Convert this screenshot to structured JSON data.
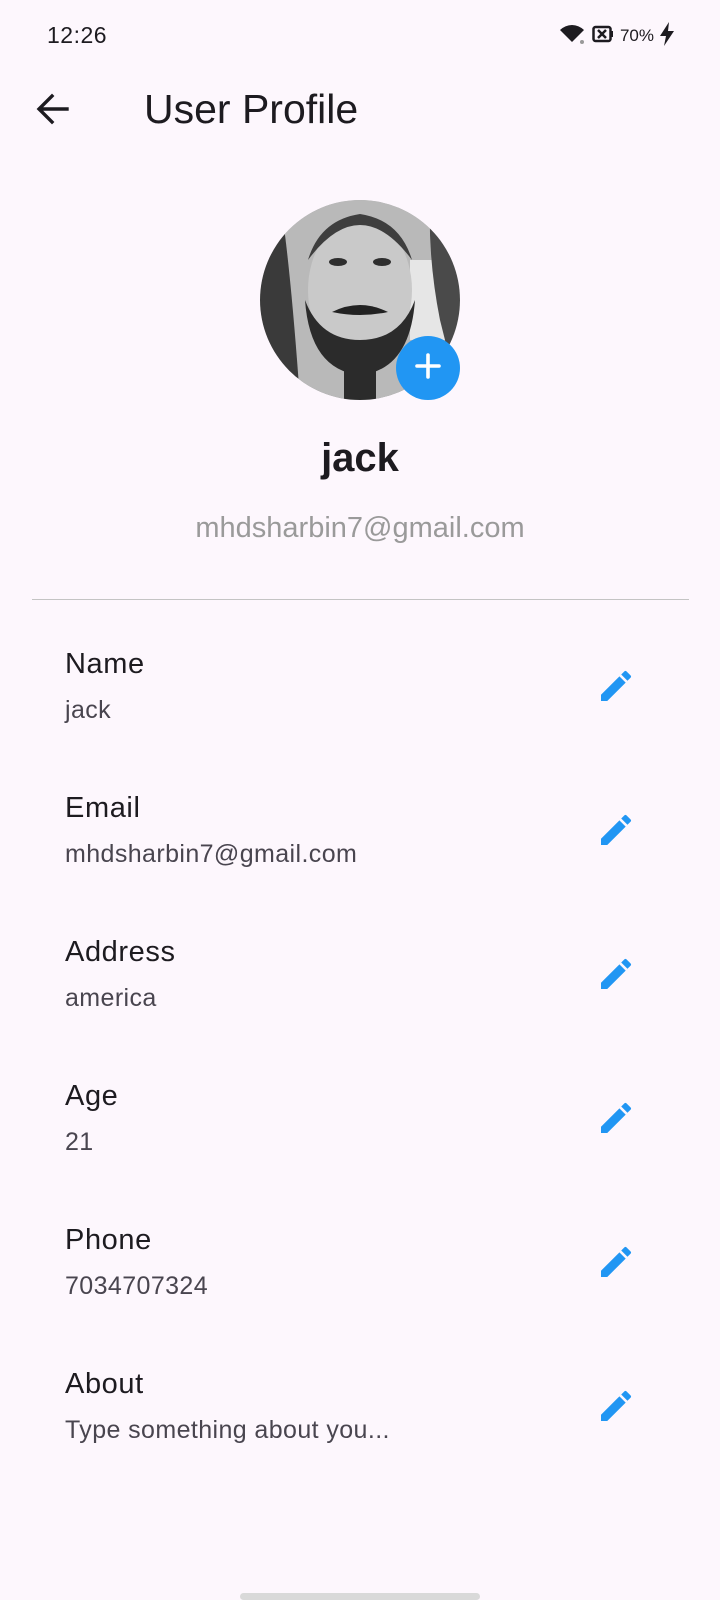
{
  "status_bar": {
    "time": "12:26",
    "battery_percent": "70%",
    "icons": [
      "wifi-icon",
      "battery-saver-icon",
      "charging-bolt-icon"
    ]
  },
  "app_bar": {
    "title": "User Profile",
    "back_icon": "arrow-back-icon"
  },
  "profile": {
    "name": "jack",
    "email": "mhdsharbin7@gmail.com",
    "add_photo_icon": "plus-icon"
  },
  "details": [
    {
      "label": "Name",
      "value": "jack",
      "icon": "pencil-icon"
    },
    {
      "label": "Email",
      "value": "mhdsharbin7@gmail.com",
      "icon": "pencil-icon"
    },
    {
      "label": "Address",
      "value": "america",
      "icon": "pencil-icon"
    },
    {
      "label": "Age",
      "value": "21",
      "icon": "pencil-icon"
    },
    {
      "label": "Phone",
      "value": "7034707324",
      "icon": "pencil-icon"
    },
    {
      "label": "About",
      "value": "Type something about you...",
      "icon": "pencil-icon"
    }
  ],
  "colors": {
    "accent": "#2196f3",
    "background": "#fdf7fd",
    "text_primary": "#1d1b20",
    "text_secondary": "#49454f",
    "text_muted": "#9a9a9a",
    "divider": "#c4c4c4"
  }
}
